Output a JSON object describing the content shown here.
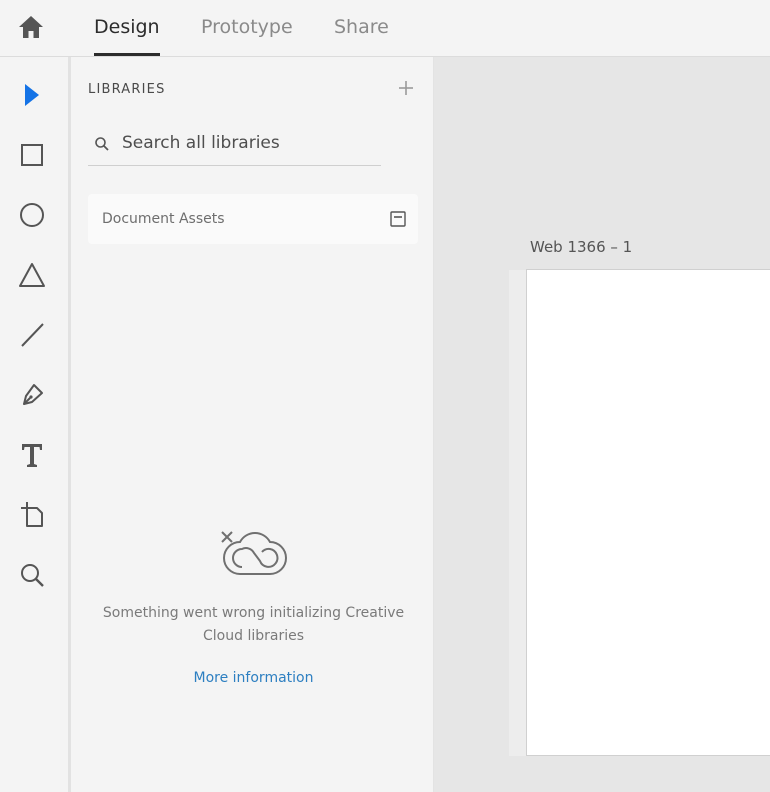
{
  "header": {
    "tabs": [
      {
        "label": "Design",
        "active": true
      },
      {
        "label": "Prototype",
        "active": false
      },
      {
        "label": "Share",
        "active": false
      }
    ]
  },
  "toolbar": {
    "tools": [
      "select-icon",
      "rectangle-icon",
      "ellipse-icon",
      "polygon-icon",
      "line-icon",
      "pen-icon",
      "text-icon",
      "artboard-icon",
      "zoom-icon"
    ],
    "active_tool": "select-icon",
    "accent_color": "#1473e6"
  },
  "libraries": {
    "title": "LIBRARIES",
    "search_placeholder": "Search all libraries",
    "document_assets_label": "Document Assets",
    "error_message": "Something went wrong initializing Creative Cloud libraries",
    "more_info_label": "More information",
    "link_color": "#2d7fc1"
  },
  "canvas": {
    "artboard_label": "Web 1366 – 1"
  }
}
